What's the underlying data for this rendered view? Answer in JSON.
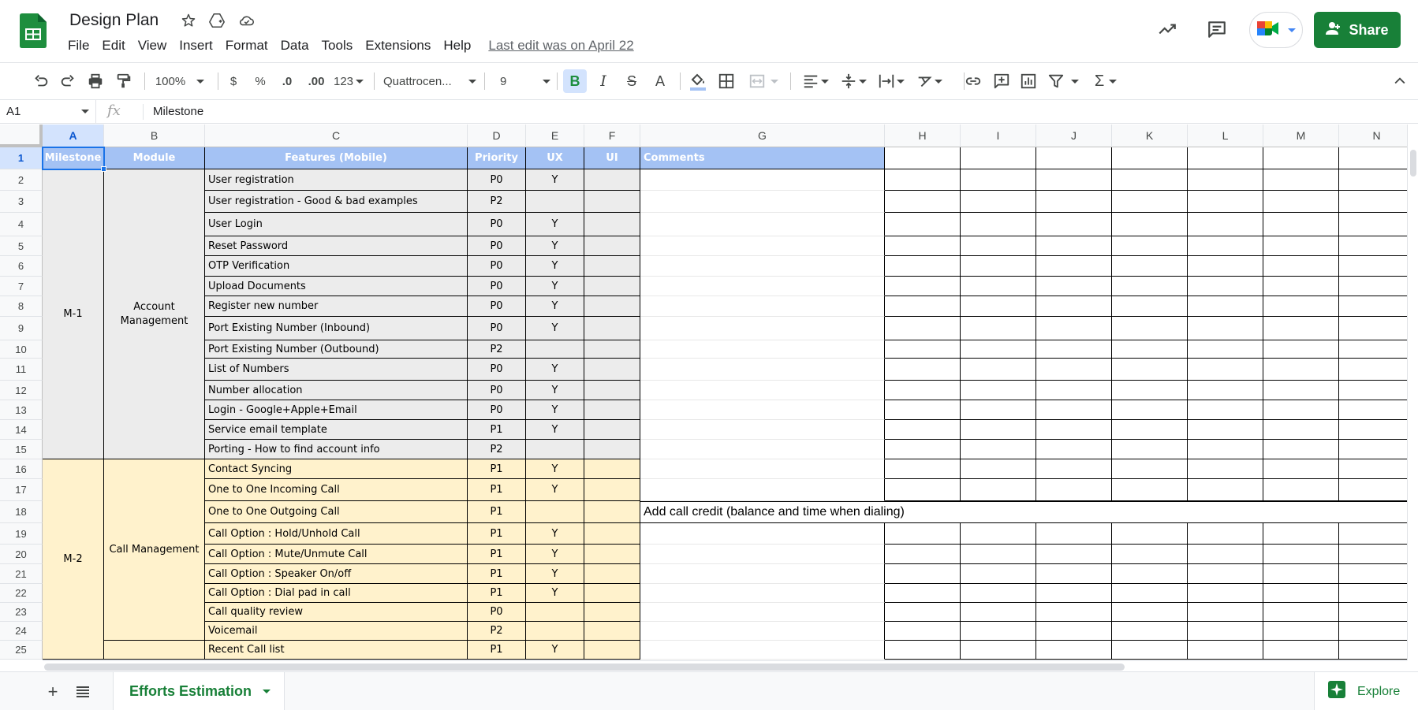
{
  "header": {
    "title": "Design Plan",
    "menu": [
      "File",
      "Edit",
      "View",
      "Insert",
      "Format",
      "Data",
      "Tools",
      "Extensions",
      "Help"
    ],
    "last_edit": "Last edit was on April 22",
    "share_label": "Share"
  },
  "toolbar": {
    "zoom": "100%",
    "currency": "$",
    "percent": "%",
    "dec_decrease": ".0",
    "dec_increase": ".00",
    "more_formats": "123",
    "font": "Quattrocen...",
    "font_size": "9"
  },
  "formula_bar": {
    "name_box": "A1",
    "fx": "fx",
    "value": "Milestone"
  },
  "grid": {
    "columns": [
      "A",
      "B",
      "C",
      "D",
      "E",
      "F",
      "G",
      "H",
      "I",
      "J",
      "K",
      "L",
      "M",
      "N"
    ],
    "rows": [
      "1",
      "2",
      "3",
      "4",
      "5",
      "6",
      "7",
      "8",
      "9",
      "10",
      "11",
      "12",
      "13",
      "14",
      "15",
      "16",
      "17",
      "18",
      "19",
      "20",
      "21",
      "22",
      "23",
      "24",
      "25"
    ],
    "headers": {
      "milestone": "Milestone",
      "module": "Module",
      "features": "Features (Mobile)",
      "priority": "Priority",
      "ux": "UX",
      "ui": "UI",
      "comments": "Comments"
    },
    "milestones": [
      "M-1",
      "M-2"
    ],
    "modules": [
      "Account Management",
      "Call Management"
    ],
    "features": [
      {
        "name": "User registration",
        "priority": "P0",
        "ux": "Y"
      },
      {
        "name": "User registration - Good & bad examples",
        "priority": "P2",
        "ux": ""
      },
      {
        "name": "User Login",
        "priority": "P0",
        "ux": "Y"
      },
      {
        "name": "Reset Password",
        "priority": "P0",
        "ux": "Y"
      },
      {
        "name": "OTP Verification",
        "priority": "P0",
        "ux": "Y"
      },
      {
        "name": "Upload Documents",
        "priority": "P0",
        "ux": "Y"
      },
      {
        "name": "Register new number",
        "priority": "P0",
        "ux": "Y"
      },
      {
        "name": "Port Existing Number (Inbound)",
        "priority": "P0",
        "ux": "Y"
      },
      {
        "name": "Port Existing Number (Outbound)",
        "priority": "P2",
        "ux": ""
      },
      {
        "name": "List of Numbers",
        "priority": "P0",
        "ux": "Y"
      },
      {
        "name": "Number allocation",
        "priority": "P0",
        "ux": "Y"
      },
      {
        "name": "Login - Google+Apple+Email",
        "priority": "P0",
        "ux": "Y"
      },
      {
        "name": "Service email template",
        "priority": "P1",
        "ux": "Y"
      },
      {
        "name": "Porting - How to find account info",
        "priority": "P2",
        "ux": ""
      },
      {
        "name": "Contact Syncing",
        "priority": "P1",
        "ux": "Y"
      },
      {
        "name": "One to One Incoming Call",
        "priority": "P1",
        "ux": "Y"
      },
      {
        "name": "One to One Outgoing Call",
        "priority": "P1",
        "ux": ""
      },
      {
        "name": "Call Option : Hold/Unhold Call",
        "priority": "P1",
        "ux": "Y"
      },
      {
        "name": "Call Option : Mute/Unmute Call",
        "priority": "P1",
        "ux": "Y"
      },
      {
        "name": "Call Option : Speaker On/off",
        "priority": "P1",
        "ux": "Y"
      },
      {
        "name": "Call Option : Dial pad in call",
        "priority": "P1",
        "ux": "Y"
      },
      {
        "name": "Call quality review",
        "priority": "P0",
        "ux": ""
      },
      {
        "name": "Voicemail",
        "priority": "P2",
        "ux": ""
      },
      {
        "name": "Recent Call list",
        "priority": "P1",
        "ux": "Y"
      }
    ],
    "comment_row18": "Add call credit (balance and time when dialing)"
  },
  "sheet_tabs": {
    "active": "Efforts Estimation",
    "explore": "Explore"
  },
  "colors": {
    "header_blue": "#a4c2f4",
    "m1_grey": "#ececec",
    "m2_yellow": "#fff2cc",
    "brand_green": "#188038",
    "selection": "#1a73e8"
  }
}
